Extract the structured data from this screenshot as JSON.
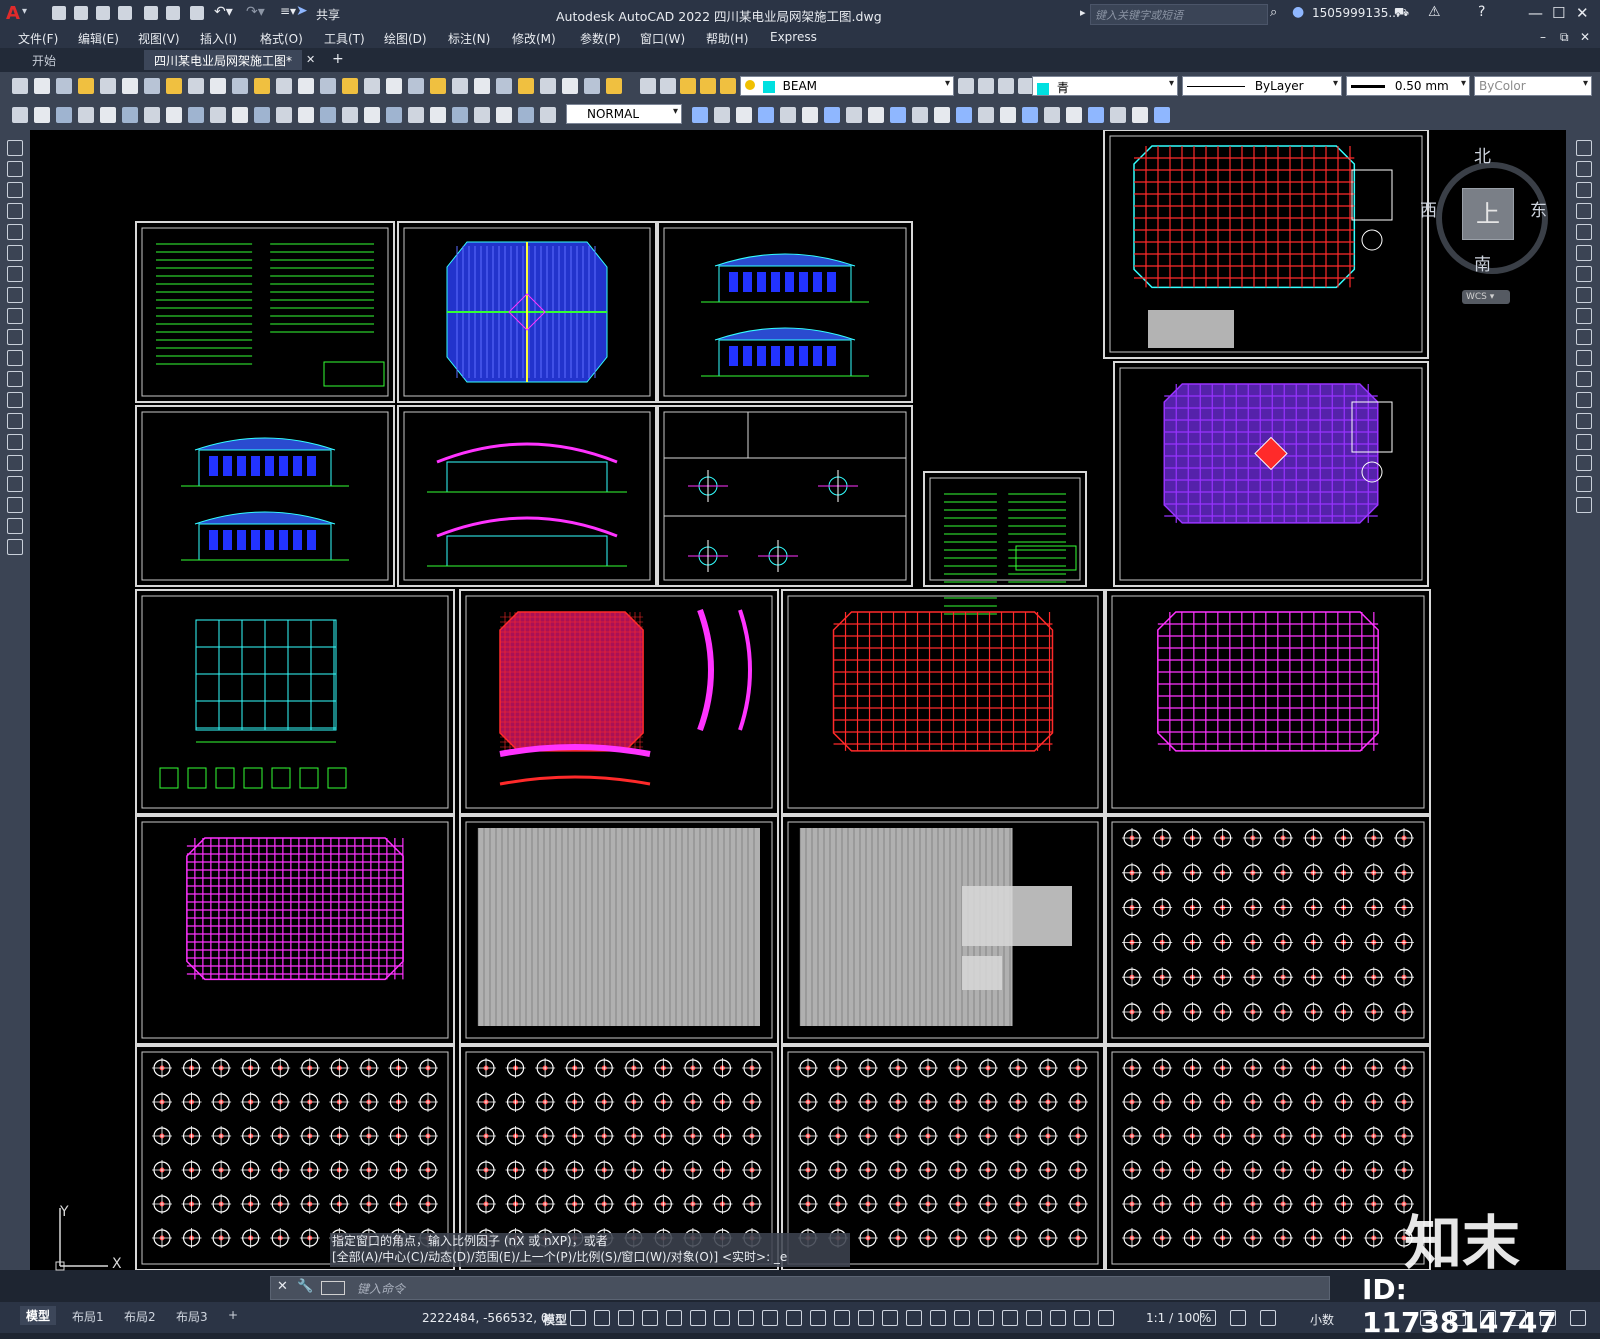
{
  "titlebar": {
    "app_title": "Autodesk AutoCAD 2022    四川某电业局网架施工图.dwg",
    "share_label": "共享",
    "search_placeholder": "键入关键字或短语",
    "user": "1505999135...",
    "app_logo": "A"
  },
  "menu": [
    "文件(F)",
    "编辑(E)",
    "视图(V)",
    "插入(I)",
    "格式(O)",
    "工具(T)",
    "绘图(D)",
    "标注(N)",
    "修改(M)",
    "参数(P)",
    "窗口(W)",
    "帮助(H)",
    "Express"
  ],
  "tabs": {
    "start": "开始",
    "active": "四川某电业局网架施工图*",
    "add": "+"
  },
  "toolbar": {
    "layer": "BEAM",
    "color": "青",
    "linetype": "ByLayer",
    "lineweight": "0.50 mm",
    "plotstyle": "ByColor",
    "dimstyle": "NORMAL"
  },
  "viewcube": {
    "north": "北",
    "south": "南",
    "east": "东",
    "west": "西",
    "top": "上",
    "wcs": "WCS"
  },
  "command": {
    "history1": "指定窗口的角点，输入比例因子 (nX 或 nXP)，或者",
    "history2": "[全部(A)/中心(C)/动态(D)/范围(E)/上一个(P)/比例(S)/窗口(W)/对象(O)] <实时>: _e",
    "placeholder": "键入命令"
  },
  "layout_tabs": [
    "模型",
    "布局1",
    "布局2",
    "布局3"
  ],
  "status": {
    "coords": "2222484, -566532, 0",
    "model": "模型",
    "scale": "1:1 / 100%",
    "units": "小数"
  },
  "ucs": {
    "y": "Y",
    "x": "X"
  },
  "watermark": {
    "logo": "知末",
    "id": "ID: 1173814747"
  },
  "colors": {
    "canvas": "#000000",
    "grid_red": "#ff2a2a",
    "grid_magenta": "#ff33ff",
    "cyan": "#33ffff",
    "green": "#33ff33",
    "blue": "#3333ff"
  }
}
